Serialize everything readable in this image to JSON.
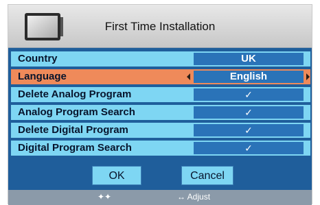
{
  "window": {
    "title": "First Time Installation",
    "icon": "tv-icon"
  },
  "rows": [
    {
      "label": "Country",
      "value": "UK"
    },
    {
      "label": "Language",
      "value": "English"
    },
    {
      "label": "Delete Analog Program",
      "value": "✓"
    },
    {
      "label": "Analog Program Search",
      "value": "✓"
    },
    {
      "label": "Delete Digital Program",
      "value": "✓"
    },
    {
      "label": "Digital Program Search",
      "value": "✓"
    }
  ],
  "buttons": {
    "ok": "OK",
    "cancel": "Cancel"
  },
  "footer": {
    "hint_updown": "✦✦",
    "hint_leftright": "↔ Adjust"
  },
  "colors": {
    "panel": "#1f5e9b",
    "row": "#7ed6f3",
    "row_selected": "#ef8a5a",
    "value_box": "#2a73b8",
    "footer": "#8b9aa9"
  }
}
